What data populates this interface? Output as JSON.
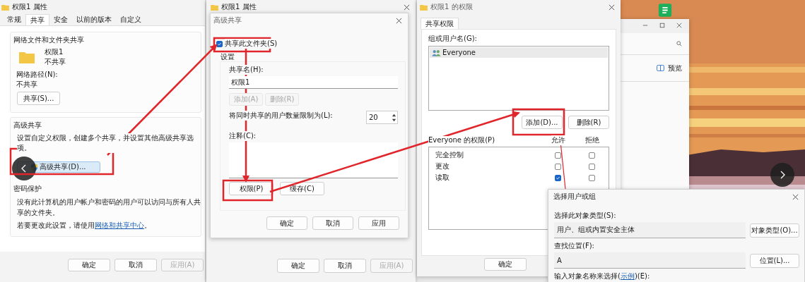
{
  "properties_window": {
    "title": "权限1 属性",
    "tabs": [
      {
        "label": "常规",
        "selected": false
      },
      {
        "label": "共享",
        "selected": true
      },
      {
        "label": "安全",
        "selected": false
      },
      {
        "label": "以前的版本",
        "selected": false
      },
      {
        "label": "自定义",
        "selected": false
      }
    ],
    "network_group": {
      "title": "网络文件和文件夹共享",
      "folder_name": "权限1",
      "folder_status": "不共享",
      "path_label": "网络路径(N):",
      "path_value": "不共享",
      "share_button": "共享(S)..."
    },
    "advanced_group": {
      "title": "高级共享",
      "description": "设置自定义权限，创建多个共享，并设置其他高级共享选项。",
      "button": "高级共享(D)..."
    },
    "password_group": {
      "title": "密码保护",
      "text": "没有此计算机的用户帐户和密码的用户可以访问与所有人共享的文件夹。",
      "change_before": "若要更改此设置，请使用",
      "change_link": "网络和共享中心",
      "change_after": "。"
    },
    "buttons": [
      {
        "label": "确定",
        "disabled": false
      },
      {
        "label": "取消",
        "disabled": false
      },
      {
        "label": "应用(A)",
        "disabled": true
      }
    ]
  },
  "back_window": {
    "title": "权限1 属性",
    "buttons": [
      {
        "label": "确定",
        "disabled": false
      },
      {
        "label": "取消",
        "disabled": false
      },
      {
        "label": "应用(A)",
        "disabled": true
      }
    ]
  },
  "advanced_sharing": {
    "title": "高级共享",
    "share_checkbox": {
      "label": "共享此文件夹(S)",
      "checked": true
    },
    "settings_title": "设置",
    "share_name_label": "共享名(H):",
    "share_name_value": "权限1",
    "name_buttons": [
      {
        "label": "添加(A)",
        "disabled": true
      },
      {
        "label": "删除(R)",
        "disabled": true
      }
    ],
    "limit_label": "将同时共享的用户数量限制为(L):",
    "limit_value": "20",
    "comment_label": "注释(C):",
    "action_buttons": [
      {
        "label": "权限(P)",
        "disabled": false
      },
      {
        "label": "缓存(C)",
        "disabled": false
      }
    ],
    "buttons": [
      {
        "label": "确定",
        "disabled": false
      },
      {
        "label": "取消",
        "disabled": false
      },
      {
        "label": "应用",
        "disabled": false
      }
    ]
  },
  "permissions_window": {
    "title": "权限1 的权限",
    "tab": {
      "label": "共享权限",
      "selected": true
    },
    "users_label": "组或用户名(G):",
    "users": [
      {
        "name": "Everyone",
        "selected": true
      }
    ],
    "user_buttons": [
      {
        "label": "添加(D)...",
        "disabled": false
      },
      {
        "label": "删除(R)",
        "disabled": false
      }
    ],
    "permissions_label": "Everyone 的权限(P)",
    "allow_header": "允许",
    "deny_header": "拒绝",
    "permissions": [
      {
        "name": "完全控制",
        "allow": false,
        "deny": false
      },
      {
        "name": "更改",
        "allow": false,
        "deny": false
      },
      {
        "name": "读取",
        "allow": true,
        "deny": false
      }
    ],
    "buttons": [
      {
        "label": "确定",
        "disabled": false
      }
    ]
  },
  "explorer": {
    "preview_label": "预览"
  },
  "select_dialog": {
    "title": "选择用户或组",
    "type_label": "选择此对象类型(S):",
    "type_value": "用户、组或内置安全主体",
    "type_button": "对象类型(O)...",
    "location_label": "查找位置(F):",
    "location_value": "A",
    "location_button": "位置(L)...",
    "name_before": "输入对象名称来选择(",
    "name_link": "示例",
    "name_after": ")(E):"
  }
}
